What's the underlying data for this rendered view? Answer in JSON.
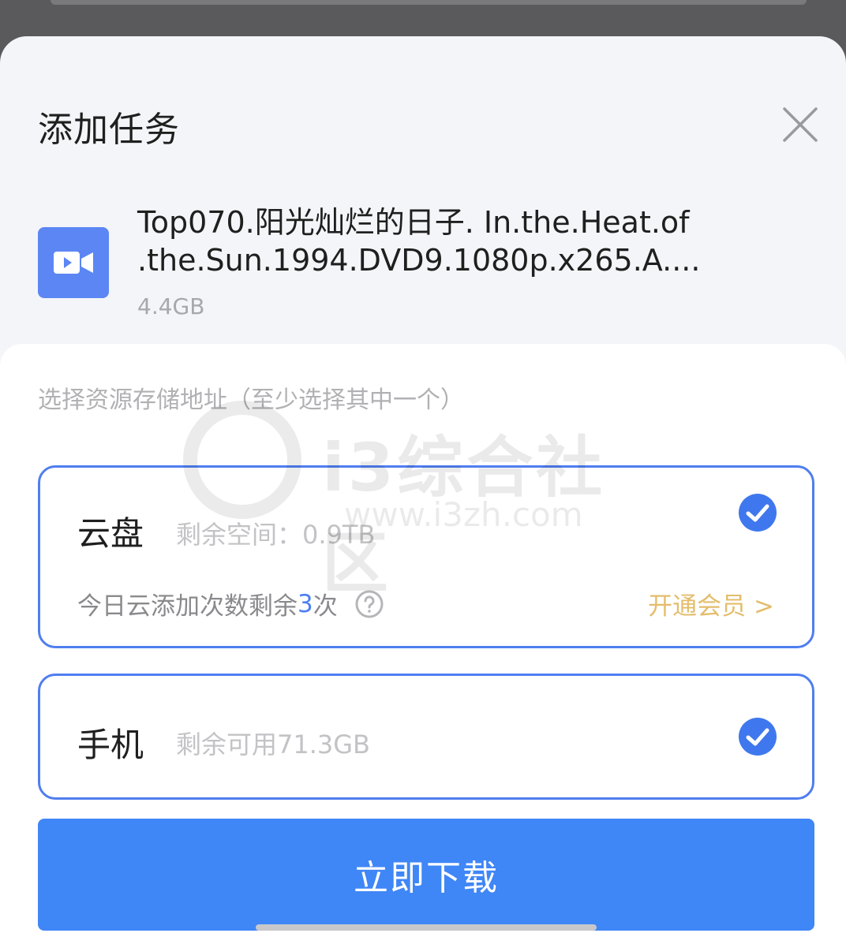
{
  "dialog": {
    "title": "添加任务"
  },
  "file": {
    "icon": "video-camera-icon",
    "name_line1": "Top070.阳光灿烂的日子. In.the.Heat.of",
    "name_line2": ".the.Sun.1994.DVD9.1080p.x265.A....",
    "size": "4.4GB"
  },
  "storage": {
    "hint": "选择资源存储地址（至少选择其中一个）",
    "cloud": {
      "title": "云盘",
      "remaining": "剩余空间：0.9TB",
      "count_prefix": "今日云添加次数剩余",
      "count_value": "3",
      "count_suffix": "次",
      "vip_link": "开通会员 >",
      "selected": true
    },
    "phone": {
      "title": "手机",
      "remaining": "剩余可用71.3GB",
      "selected": true
    }
  },
  "actions": {
    "download_label": "立即下载"
  },
  "watermark": {
    "name": "i3综合社区",
    "url": "www.i3zh.com"
  },
  "colors": {
    "accent": "#3f86f7",
    "card_border": "#4f7ef0",
    "vip_gold": "#e3bd6c"
  }
}
